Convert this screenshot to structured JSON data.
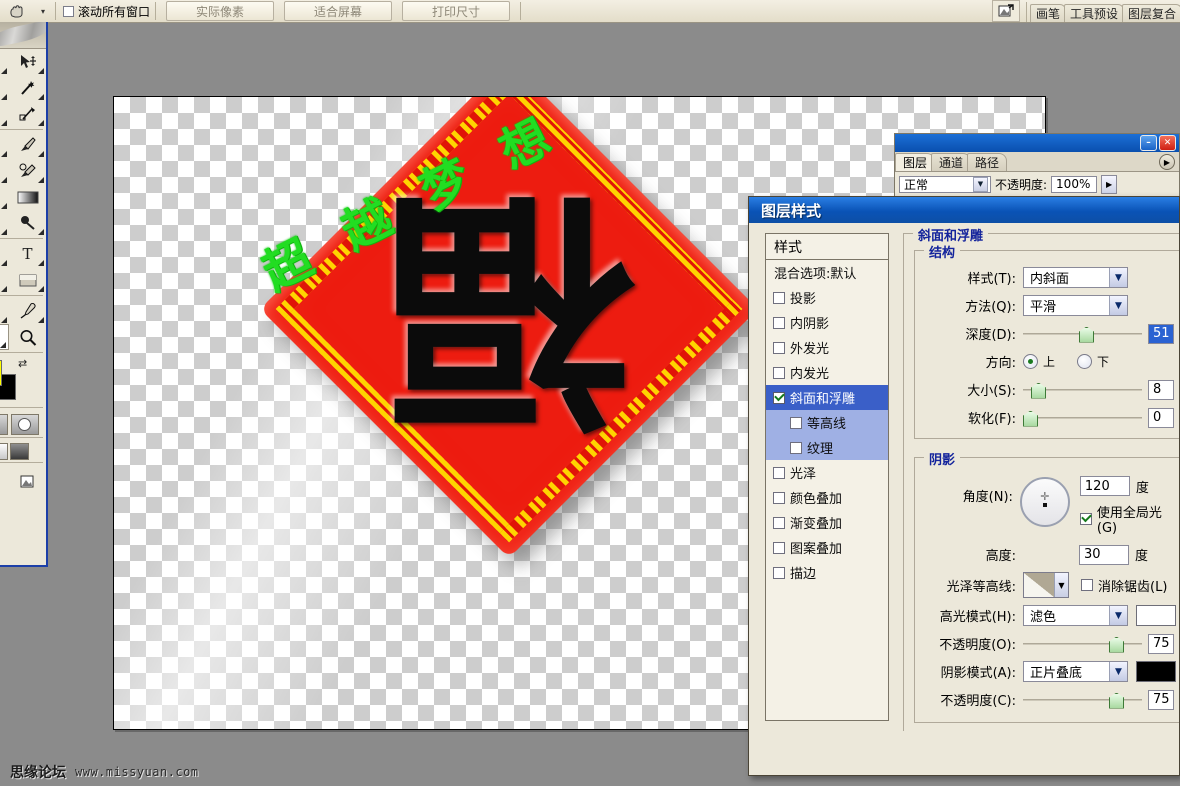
{
  "options_bar": {
    "tool_icon": "hand-tool-icon",
    "preset_caret": "▾",
    "scroll_all_windows": {
      "label": "滚动所有窗口",
      "checked": false
    },
    "buttons": [
      {
        "label": "实际像素"
      },
      {
        "label": "适合屏幕"
      },
      {
        "label": "打印尺寸"
      }
    ],
    "palette_well": {
      "icon": "image-ready-icon",
      "tabs": [
        "画笔",
        "工具预设",
        "图层复合"
      ]
    }
  },
  "toolbox": {
    "tools": [
      [
        "marquee-icon",
        "move-icon"
      ],
      [
        "lasso-icon",
        "magic-wand-icon"
      ],
      [
        "crop-icon",
        "slice-icon"
      ],
      [
        "healing-brush-icon",
        "brush-icon"
      ],
      [
        "stamp-icon",
        "history-brush-icon"
      ],
      [
        "eraser-icon",
        "gradient-icon"
      ],
      [
        "blur-icon",
        "dodge-icon"
      ],
      [
        "path-selection-icon",
        "type-icon"
      ],
      [
        "pen-icon",
        "shape-icon"
      ],
      [
        "notes-icon",
        "eyedropper-icon"
      ],
      [
        "hand-icon",
        "zoom-icon"
      ]
    ],
    "foreground_color": "#ffff00",
    "background_color": "#000000",
    "swap_icon": "swap-colors-icon"
  },
  "document": {
    "artwork": {
      "green_text": "超 越 梦 想",
      "green_text_color": "#22dd22",
      "diamond_color": "#ed1c10",
      "gold_color": "#ffd400",
      "fu_character": "福"
    }
  },
  "layers_palette": {
    "window_buttons": {
      "minimize": "–",
      "close": "✕"
    },
    "tabs": [
      "图层",
      "通道",
      "路径"
    ],
    "active_tab": "图层",
    "menu_icon": "palette-menu-icon",
    "blend_mode": "正常",
    "opacity_label": "不透明度:",
    "opacity_value": "100%"
  },
  "layer_style_dialog": {
    "title": "图层样式",
    "styles_header": "样式",
    "styles": [
      {
        "label": "混合选项:默认",
        "type": "plain"
      },
      {
        "label": "投影",
        "type": "check",
        "checked": false
      },
      {
        "label": "内阴影",
        "type": "check",
        "checked": false
      },
      {
        "label": "外发光",
        "type": "check",
        "checked": false
      },
      {
        "label": "内发光",
        "type": "check",
        "checked": false
      },
      {
        "label": "斜面和浮雕",
        "type": "check",
        "checked": true,
        "selected": true
      },
      {
        "label": "等高线",
        "type": "sub",
        "checked": false
      },
      {
        "label": "纹理",
        "type": "sub",
        "checked": false
      },
      {
        "label": "光泽",
        "type": "check",
        "checked": false
      },
      {
        "label": "颜色叠加",
        "type": "check",
        "checked": false
      },
      {
        "label": "渐变叠加",
        "type": "check",
        "checked": false
      },
      {
        "label": "图案叠加",
        "type": "check",
        "checked": false
      },
      {
        "label": "描边",
        "type": "check",
        "checked": false
      }
    ],
    "panel_title": "斜面和浮雕",
    "structure": {
      "legend": "结构",
      "style_label": "样式(T):",
      "style_value": "内斜面",
      "technique_label": "方法(Q):",
      "technique_value": "平滑",
      "depth_label": "深度(D):",
      "depth_value": "51",
      "depth_unit": "%",
      "direction_label": "方向:",
      "direction_up": "上",
      "direction_down": "下",
      "direction_selected": "上",
      "size_label": "大小(S):",
      "size_value": "8",
      "soften_label": "软化(F):",
      "soften_value": "0"
    },
    "shading": {
      "legend": "阴影",
      "angle_label": "角度(N):",
      "angle_value": "120",
      "angle_unit": "度",
      "use_global_light": "使用全局光(G)",
      "use_global_light_checked": true,
      "altitude_label": "高度:",
      "altitude_value": "30",
      "altitude_unit": "度",
      "gloss_contour_label": "光泽等高线:",
      "anti_alias_label": "消除锯齿(L)",
      "anti_alias_checked": false,
      "highlight_mode_label": "高光模式(H):",
      "highlight_mode_value": "滤色",
      "highlight_color": "#ffffff",
      "highlight_opacity_label": "不透明度(O):",
      "highlight_opacity_value": "75",
      "shadow_mode_label": "阴影模式(A):",
      "shadow_mode_value": "正片叠底",
      "shadow_color": "#000000",
      "shadow_opacity_label": "不透明度(C):",
      "shadow_opacity_value": "75"
    }
  },
  "watermark": {
    "site_name": "思缘论坛",
    "url": "www.missyuan.com"
  }
}
